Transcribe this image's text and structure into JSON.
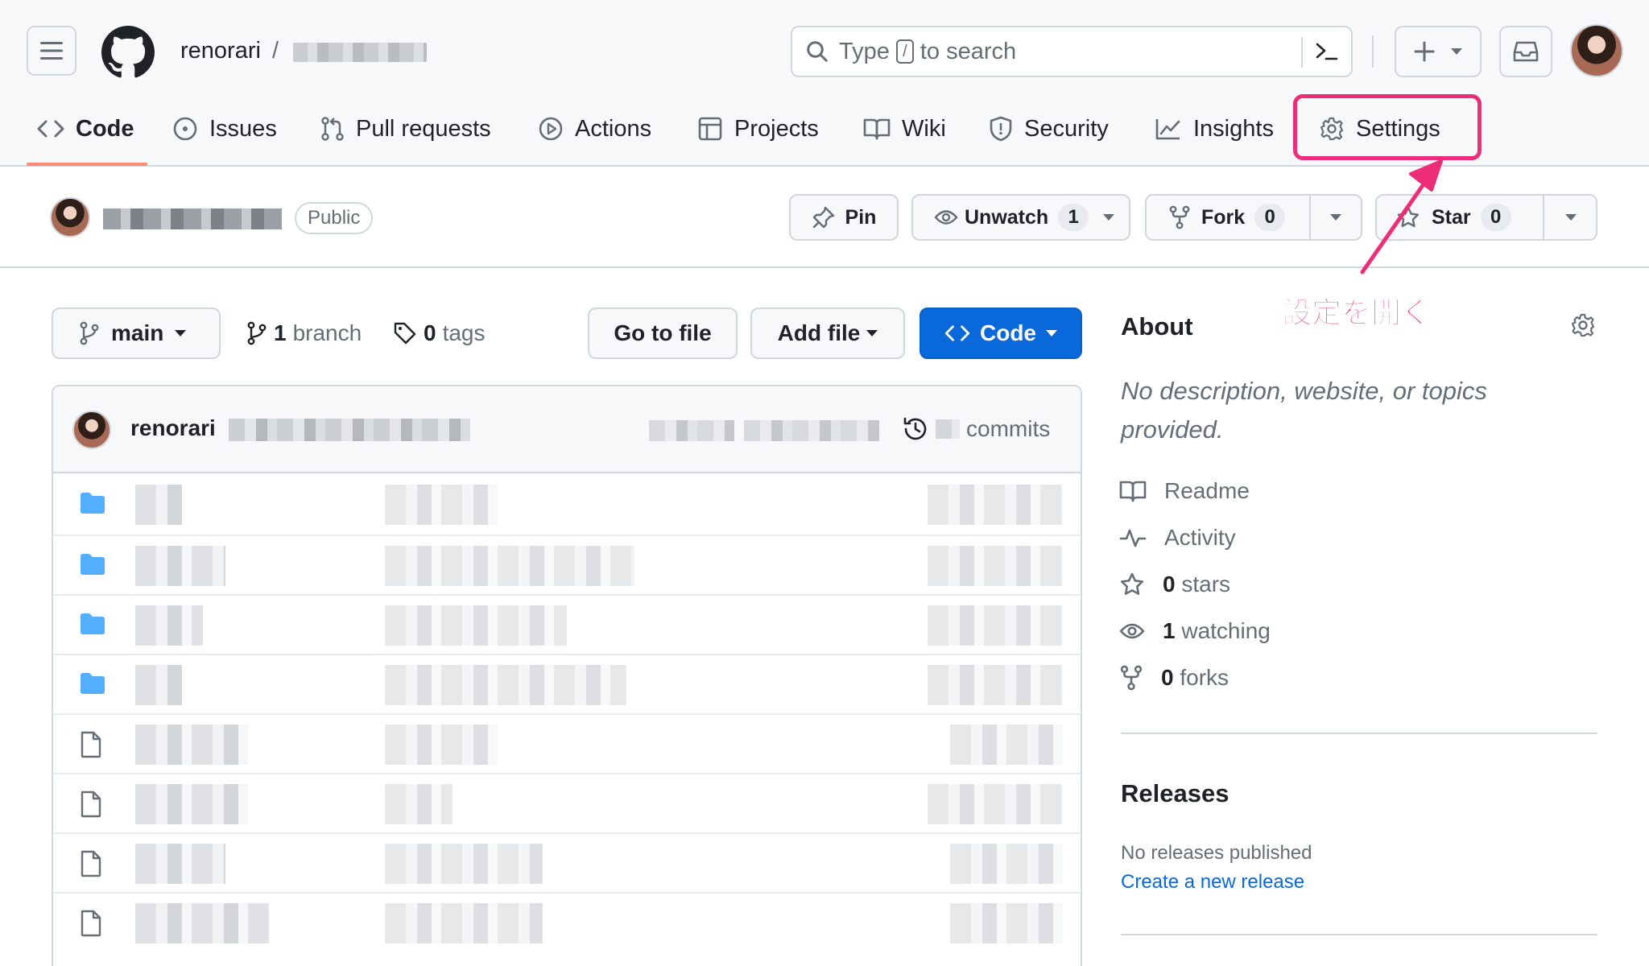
{
  "header": {
    "owner": "renorari",
    "separator": "/",
    "search": {
      "prefix": "Type",
      "key": "/",
      "suffix": "to search"
    }
  },
  "tabs": [
    {
      "label": "Code",
      "icon": "code-icon"
    },
    {
      "label": "Issues",
      "icon": "issue-icon"
    },
    {
      "label": "Pull requests",
      "icon": "pull-request-icon"
    },
    {
      "label": "Actions",
      "icon": "play-icon"
    },
    {
      "label": "Projects",
      "icon": "table-icon"
    },
    {
      "label": "Wiki",
      "icon": "book-icon"
    },
    {
      "label": "Security",
      "icon": "shield-icon"
    },
    {
      "label": "Insights",
      "icon": "graph-icon"
    },
    {
      "label": "Settings",
      "icon": "gear-icon"
    }
  ],
  "repo": {
    "visibility": "Public",
    "pin": "Pin",
    "unwatch": "Unwatch",
    "unwatch_count": "1",
    "fork": "Fork",
    "fork_count": "0",
    "star": "Star",
    "star_count": "0"
  },
  "toolbar": {
    "branch": "main",
    "branch_count": "1",
    "branch_label": "branch",
    "tag_count": "0",
    "tag_label": "tags",
    "go_to_file": "Go to file",
    "add_file": "Add file",
    "code": "Code"
  },
  "commit": {
    "author": "renorari",
    "commits_label": "commits"
  },
  "files": [
    {
      "type": "folder"
    },
    {
      "type": "folder"
    },
    {
      "type": "folder"
    },
    {
      "type": "folder"
    },
    {
      "type": "file"
    },
    {
      "type": "file"
    },
    {
      "type": "file"
    },
    {
      "type": "file"
    }
  ],
  "about": {
    "title": "About",
    "description": "No description, website, or topics provided.",
    "readme": "Readme",
    "activity": "Activity",
    "stars_count": "0",
    "stars_label": "stars",
    "watching_count": "1",
    "watching_label": "watching",
    "forks_count": "0",
    "forks_label": "forks"
  },
  "releases": {
    "title": "Releases",
    "none": "No releases published",
    "create": "Create a new release"
  },
  "annotation": {
    "text": "設定を開く",
    "color": "#ee2d7a"
  },
  "colors": {
    "accent": "#0969da",
    "tab_underline": "#fd8c73",
    "folder": "#54aeff"
  }
}
